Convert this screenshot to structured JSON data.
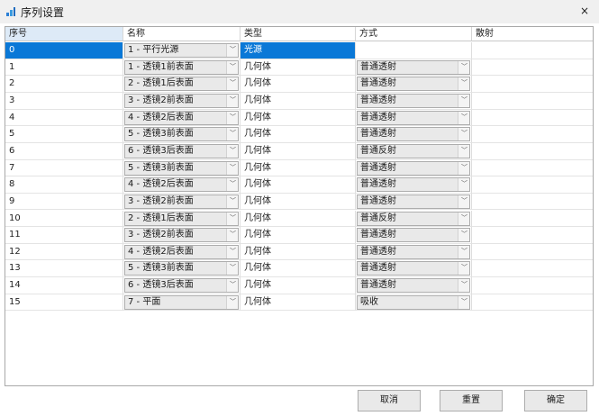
{
  "window": {
    "title": "序列设置",
    "close_glyph": "×",
    "icon": "sequence-icon"
  },
  "columns": [
    "序号",
    "名称",
    "类型",
    "方式",
    "散射"
  ],
  "rows": [
    {
      "idx": "0",
      "name": "1 - 平行光源",
      "type": "光源",
      "mode": "",
      "scatter": ""
    },
    {
      "idx": "1",
      "name": "1 - 透镜1前表面",
      "type": "几何体",
      "mode": "普通透射",
      "scatter": ""
    },
    {
      "idx": "2",
      "name": "2 - 透镜1后表面",
      "type": "几何体",
      "mode": "普通透射",
      "scatter": ""
    },
    {
      "idx": "3",
      "name": "3 - 透镜2前表面",
      "type": "几何体",
      "mode": "普通透射",
      "scatter": ""
    },
    {
      "idx": "4",
      "name": "4 - 透镜2后表面",
      "type": "几何体",
      "mode": "普通透射",
      "scatter": ""
    },
    {
      "idx": "5",
      "name": "5 - 透镜3前表面",
      "type": "几何体",
      "mode": "普通透射",
      "scatter": ""
    },
    {
      "idx": "6",
      "name": "6 - 透镜3后表面",
      "type": "几何体",
      "mode": "普通反射",
      "scatter": ""
    },
    {
      "idx": "7",
      "name": "5 - 透镜3前表面",
      "type": "几何体",
      "mode": "普通透射",
      "scatter": ""
    },
    {
      "idx": "8",
      "name": "4 - 透镜2后表面",
      "type": "几何体",
      "mode": "普通透射",
      "scatter": ""
    },
    {
      "idx": "9",
      "name": "3 - 透镜2前表面",
      "type": "几何体",
      "mode": "普通透射",
      "scatter": ""
    },
    {
      "idx": "10",
      "name": "2 - 透镜1后表面",
      "type": "几何体",
      "mode": "普通反射",
      "scatter": ""
    },
    {
      "idx": "11",
      "name": "3 - 透镜2前表面",
      "type": "几何体",
      "mode": "普通透射",
      "scatter": ""
    },
    {
      "idx": "12",
      "name": "4 - 透镜2后表面",
      "type": "几何体",
      "mode": "普通透射",
      "scatter": ""
    },
    {
      "idx": "13",
      "name": "5 - 透镜3前表面",
      "type": "几何体",
      "mode": "普通透射",
      "scatter": ""
    },
    {
      "idx": "14",
      "name": "6 - 透镜3后表面",
      "type": "几何体",
      "mode": "普通透射",
      "scatter": ""
    },
    {
      "idx": "15",
      "name": "7 - 平面",
      "type": "几何体",
      "mode": "吸收",
      "scatter": ""
    }
  ],
  "selected_row": 0,
  "buttons": {
    "cancel": "取消",
    "reset": "重置",
    "ok": "确定"
  },
  "dropdown_glyph": "﹀",
  "colors": {
    "selection": "#0a78d7",
    "header_first": "#ddeaf7"
  }
}
